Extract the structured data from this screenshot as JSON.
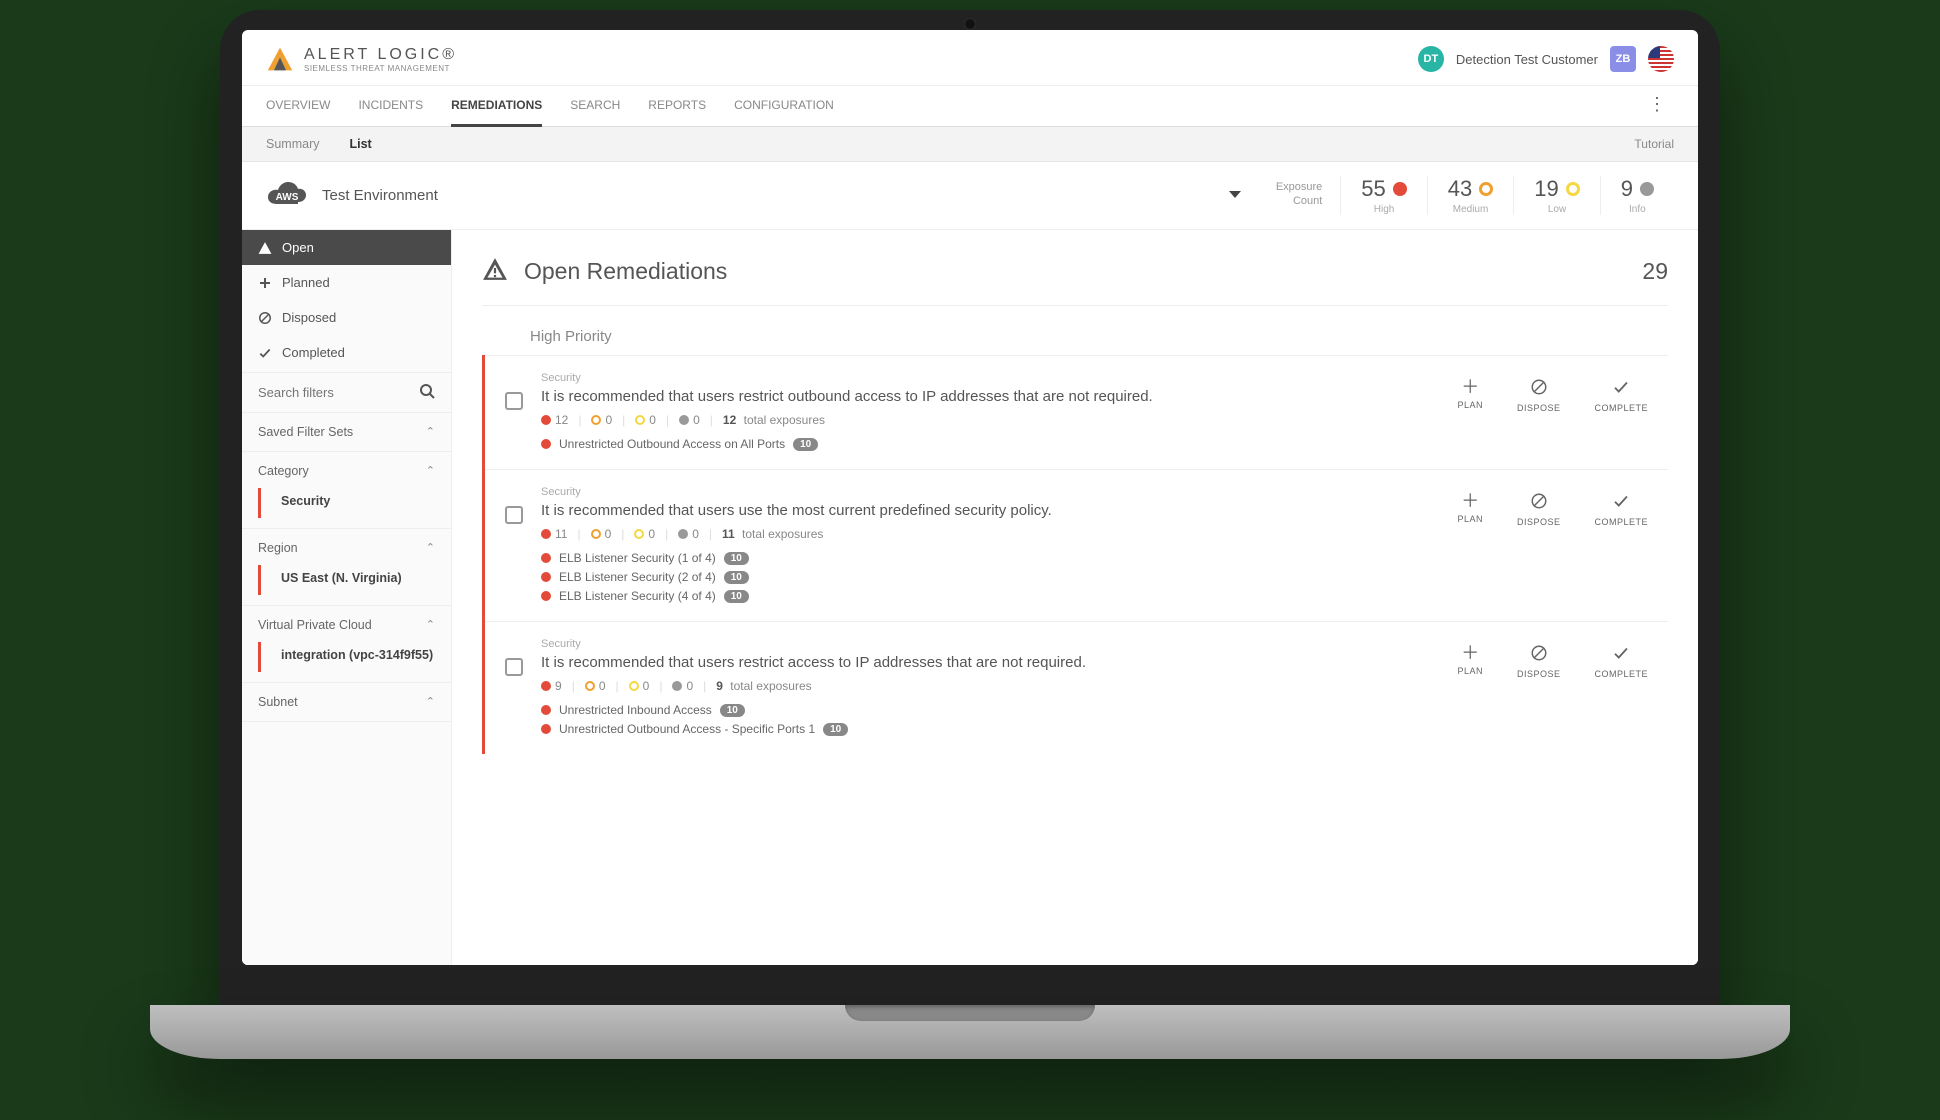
{
  "logo": {
    "main": "ALERT LOGIC®",
    "sub": "SIEMLESS THREAT MANAGEMENT"
  },
  "header": {
    "avatar_initials": "DT",
    "user_name": "Detection Test Customer",
    "avatar2_initials": "ZB"
  },
  "tabs": [
    "OVERVIEW",
    "INCIDENTS",
    "REMEDIATIONS",
    "SEARCH",
    "REPORTS",
    "CONFIGURATION"
  ],
  "active_tab": "REMEDIATIONS",
  "subtabs": {
    "items": [
      "Summary",
      "List"
    ],
    "active": "List",
    "right": "Tutorial"
  },
  "env": {
    "name": "Test Environment",
    "provider": "AWS",
    "count_label1": "Exposure",
    "count_label2": "Count",
    "cells": [
      {
        "num": "55",
        "label": "High",
        "class": "dot-high"
      },
      {
        "num": "43",
        "label": "Medium",
        "class": "dot-med"
      },
      {
        "num": "19",
        "label": "Low",
        "class": "dot-low"
      },
      {
        "num": "9",
        "label": "Info",
        "class": "dot-info"
      }
    ]
  },
  "sidebar": {
    "states": [
      {
        "icon": "warning",
        "label": "Open",
        "active": true
      },
      {
        "icon": "plus",
        "label": "Planned"
      },
      {
        "icon": "disposed",
        "label": "Disposed"
      },
      {
        "icon": "check",
        "label": "Completed"
      }
    ],
    "search_placeholder": "Search filters",
    "sections": [
      {
        "label": "Saved Filter Sets"
      },
      {
        "label": "Category",
        "value": "Security"
      },
      {
        "label": "Region",
        "value": "US East (N. Virginia)"
      },
      {
        "label": "Virtual Private Cloud",
        "value": "integration (vpc-314f9f55)"
      },
      {
        "label": "Subnet"
      }
    ]
  },
  "main": {
    "title": "Open Remediations",
    "count": "29",
    "priority_header": "High Priority",
    "actions": {
      "plan": "PLAN",
      "dispose": "DISPOSE",
      "complete": "COMPLETE"
    },
    "cards": [
      {
        "category": "Security",
        "title": "It is recommended that users restrict outbound access to IP addresses that are not required.",
        "metrics": {
          "high": "12",
          "med": "0",
          "low": "0",
          "info": "0",
          "total_num": "12",
          "total_label": "total exposures"
        },
        "subs": [
          {
            "label": "Unrestricted Outbound Access on All Ports",
            "pill": "10"
          }
        ]
      },
      {
        "category": "Security",
        "title": "It is recommended that users use the most current predefined security policy.",
        "metrics": {
          "high": "11",
          "med": "0",
          "low": "0",
          "info": "0",
          "total_num": "11",
          "total_label": "total exposures"
        },
        "subs": [
          {
            "label": "ELB Listener Security (1 of 4)",
            "pill": "10"
          },
          {
            "label": "ELB Listener Security (2 of 4)",
            "pill": "10"
          },
          {
            "label": "ELB Listener Security (4 of 4)",
            "pill": "10"
          }
        ]
      },
      {
        "category": "Security",
        "title": "It is recommended that users restrict access to IP addresses that are not required.",
        "metrics": {
          "high": "9",
          "med": "0",
          "low": "0",
          "info": "0",
          "total_num": "9",
          "total_label": "total exposures"
        },
        "subs": [
          {
            "label": "Unrestricted Inbound Access",
            "pill": "10"
          },
          {
            "label": "Unrestricted Outbound Access - Specific Ports 1",
            "pill": "10"
          }
        ]
      }
    ]
  }
}
